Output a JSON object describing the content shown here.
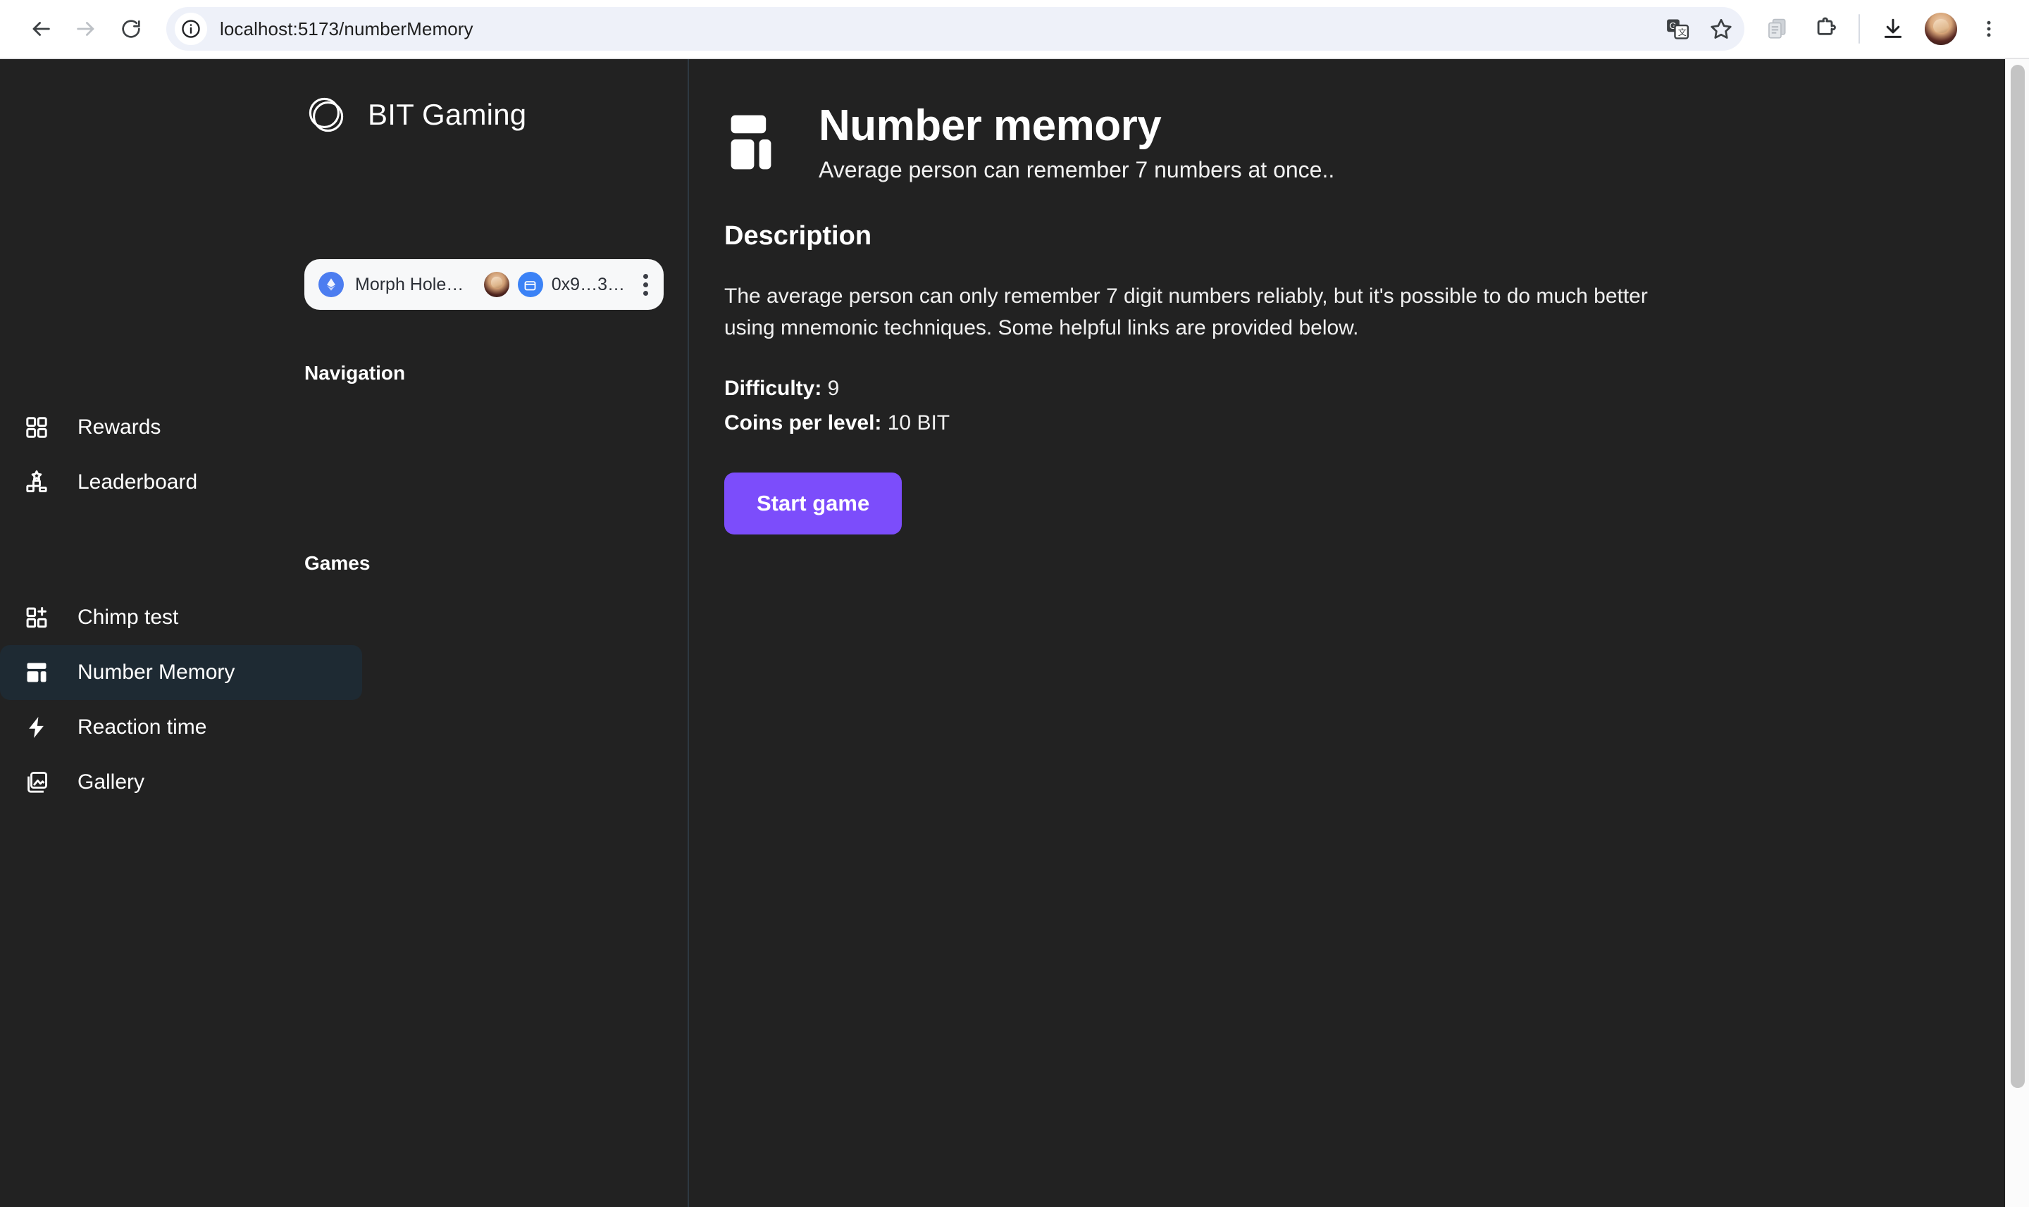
{
  "browser": {
    "back_label": "Back",
    "forward_label": "Forward",
    "reload_label": "Reload",
    "site_info_icon": "info-circle-icon",
    "url": "localhost:5173/numberMemory",
    "translate_icon": "translate-icon",
    "bookmark_icon": "star-icon",
    "copy_icon": "copy-pages-icon",
    "extensions_icon": "extensions-puzzle-icon",
    "downloads_icon": "download-icon",
    "profile_icon": "profile-avatar",
    "menu_icon": "three-dot-menu-icon"
  },
  "sidebar": {
    "brand": {
      "logo_icon": "bit-gaming-circles-logo",
      "name": "BIT Gaming"
    },
    "wallet": {
      "chain_icon": "ethereum-diamond-icon",
      "chain_name": "Morph Hole…",
      "account_avatar": "account-avatar",
      "wallet_icon": "wallet-icon",
      "address": "0x9…3…",
      "menu_icon": "kebab-menu-icon"
    },
    "sections": [
      {
        "label": "Navigation",
        "items": [
          {
            "label": "Rewards",
            "icon": "grid-squares-icon",
            "active": false
          },
          {
            "label": "Leaderboard",
            "icon": "podium-star-icon",
            "active": false
          }
        ]
      },
      {
        "label": "Games",
        "items": [
          {
            "label": "Chimp test",
            "icon": "grid-plus-icon",
            "active": false
          },
          {
            "label": "Number Memory",
            "icon": "layout-dashboard-icon",
            "active": true
          },
          {
            "label": "Reaction time",
            "icon": "lightning-bolt-icon",
            "active": false
          },
          {
            "label": "Gallery",
            "icon": "image-library-icon",
            "active": false
          }
        ]
      }
    ]
  },
  "main": {
    "game_icon": "layout-dashboard-icon",
    "title": "Number memory",
    "subtitle": "Average person can remember 7 numbers at once..",
    "description_heading": "Description",
    "description_body": "The average person can only remember 7 digit numbers reliably, but it's possible to do much better using mnemonic techniques. Some helpful links are provided below.",
    "difficulty_label": "Difficulty:",
    "difficulty_value": "9",
    "coins_label": "Coins per level:",
    "coins_value": "10 BIT",
    "start_button": "Start game"
  },
  "theme": {
    "page_background": "#222222",
    "accent_purple": "#7c4dfb",
    "active_nav_background": "#1e2a33",
    "sidebar_border": "#2e3942",
    "wallet_card_background": "#f7f8f9",
    "chain_badge_blue": "#4c7df0"
  }
}
